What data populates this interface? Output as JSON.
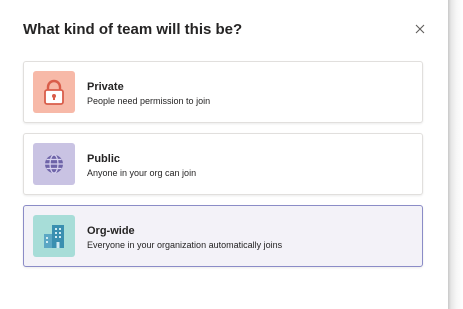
{
  "dialog": {
    "title": "What kind of team will this be?",
    "close_icon": "close-icon"
  },
  "options": [
    {
      "label": "Private",
      "description": "People need permission to join",
      "icon": "lock-icon",
      "tile_color": "#f7b9a8",
      "icon_color": "#d95d4a",
      "selected": false
    },
    {
      "label": "Public",
      "description": "Anyone in your org can join",
      "icon": "globe-icon",
      "tile_color": "#c9c3e3",
      "icon_color": "#6e64a8",
      "selected": false
    },
    {
      "label": "Org-wide",
      "description": "Everyone in your organization automatically joins",
      "icon": "building-icon",
      "tile_color": "#a7ddd8",
      "icon_color": "#3a8fb0",
      "selected": true
    }
  ],
  "colors": {
    "selected_background": "#f3f2f8",
    "selected_border": "#8b8cc7",
    "card_border": "#e1dfdd",
    "text": "#252424"
  }
}
